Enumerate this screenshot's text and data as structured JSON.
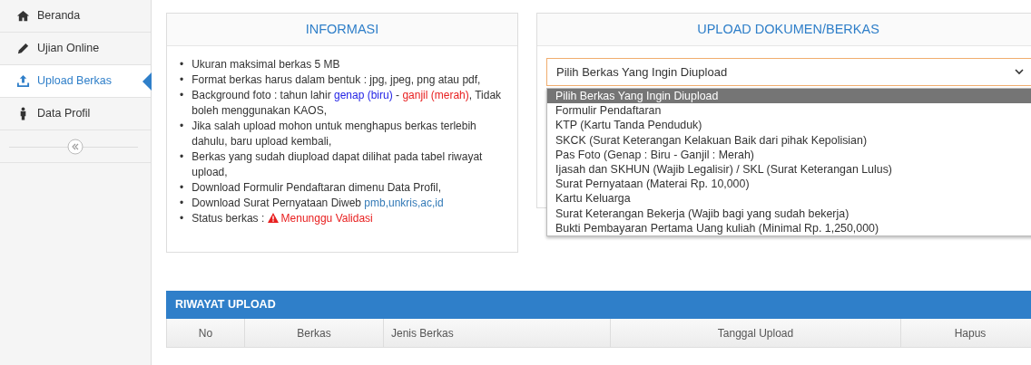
{
  "sidebar": {
    "items": [
      {
        "label": "Beranda",
        "selected": false
      },
      {
        "label": "Ujian Online",
        "selected": false
      },
      {
        "label": "Upload Berkas",
        "selected": true
      },
      {
        "label": "Data Profil",
        "selected": false
      }
    ]
  },
  "info": {
    "title": "INFORMASI",
    "items": [
      {
        "bullet": "•",
        "segments": [
          {
            "text": "Ukuran maksimal berkas 5 MB"
          }
        ]
      },
      {
        "bullet": "•",
        "segments": [
          {
            "text": "Format berkas harus dalam bentuk : jpg, jpeg, png atau pdf,"
          }
        ]
      },
      {
        "bullet": "•",
        "segments": [
          {
            "text": "Background foto : tahun lahir "
          },
          {
            "text": "genap (biru)",
            "color": "#2323e6"
          },
          {
            "text": " - "
          },
          {
            "text": "ganjil (merah)",
            "color": "#e82020"
          },
          {
            "text": ", Tidak boleh menggunakan KAOS,"
          }
        ]
      },
      {
        "bullet": "•",
        "segments": [
          {
            "text": "Jika salah upload mohon untuk menghapus berkas terlebih dahulu, baru upload kembali,"
          }
        ]
      },
      {
        "bullet": "•",
        "segments": [
          {
            "text": "Berkas yang sudah diupload dapat dilihat pada tabel riwayat upload,"
          }
        ]
      },
      {
        "bullet": "•",
        "segments": [
          {
            "text": "Download Formulir Pendaftaran dimenu Data Profil,"
          }
        ]
      },
      {
        "bullet": "•",
        "segments": [
          {
            "text": "Download Surat Pernyataan Diweb "
          },
          {
            "text": "pmb,unkris,ac,id",
            "kind": "link"
          }
        ]
      },
      {
        "bullet": "•",
        "segments": [
          {
            "text": "Status berkas : "
          },
          {
            "text": "Menunggu Validasi",
            "kind": "status"
          }
        ]
      }
    ]
  },
  "upload": {
    "title": "UPLOAD DOKUMEN/BERKAS",
    "select": {
      "value": "Pilih Berkas Yang Ingin Diupload",
      "options": [
        {
          "label": "Pilih Berkas Yang Ingin Diupload",
          "selected": true
        },
        {
          "label": "Formulir Pendaftaran",
          "selected": false
        },
        {
          "label": "KTP (Kartu Tanda Penduduk)",
          "selected": false
        },
        {
          "label": "SKCK (Surat Keterangan Kelakuan Baik dari pihak Kepolisian)",
          "selected": false
        },
        {
          "label": "Pas Foto (Genap : Biru - Ganjil : Merah)",
          "selected": false
        },
        {
          "label": "Ijasah dan SKHUN (Wajib Legalisir) / SKL (Surat Keterangan Lulus)",
          "selected": false
        },
        {
          "label": "Surat Pernyataan (Materai Rp. 10,000)",
          "selected": false
        },
        {
          "label": "Kartu Keluarga",
          "selected": false
        },
        {
          "label": "Surat Keterangan Bekerja (Wajib bagi yang sudah bekerja)",
          "selected": false
        },
        {
          "label": "Bukti Pembayaran Pertama Uang kuliah (Minimal Rp. 1,250,000)",
          "selected": false
        }
      ]
    }
  },
  "history": {
    "title": "RIWAYAT UPLOAD",
    "columns": [
      {
        "label": "No"
      },
      {
        "label": "Berkas"
      },
      {
        "label": "Jenis Berkas"
      },
      {
        "label": "Tanggal Upload"
      },
      {
        "label": "Hapus"
      }
    ]
  }
}
